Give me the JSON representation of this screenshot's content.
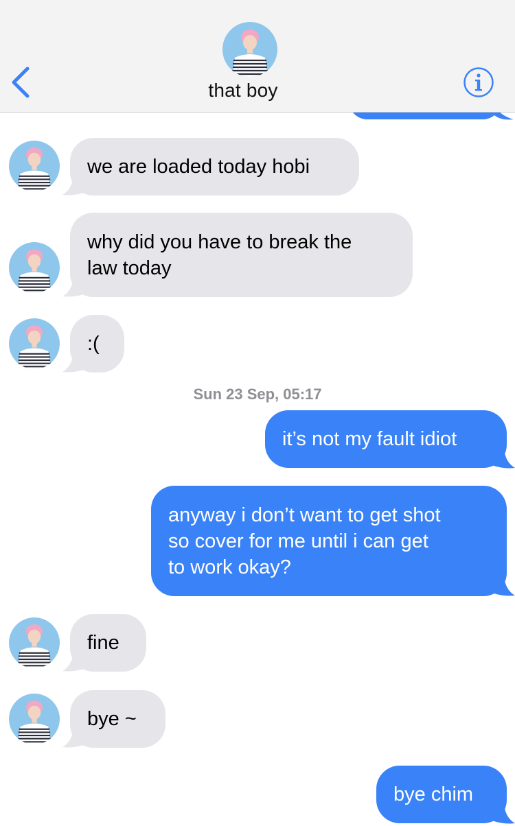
{
  "header": {
    "back_icon": "chevron-left-icon",
    "contact_name": "that boy",
    "info_icon": "info-circle-icon",
    "accent_color": "#3a82f7"
  },
  "conversation": {
    "messages": [
      {
        "direction": "incoming",
        "text": "we are loaded today hobi"
      },
      {
        "direction": "incoming",
        "text": "why did you have to break the\nlaw today"
      },
      {
        "direction": "incoming",
        "text": ":("
      },
      {
        "type": "timestamp",
        "text": "Sun 23 Sep, 05:17"
      },
      {
        "direction": "outgoing",
        "text": "it’s not my fault idiot"
      },
      {
        "direction": "outgoing",
        "text": "anyway i don’t want to get shot\nso cover for me until i can get\nto work okay?"
      },
      {
        "direction": "incoming",
        "text": "fine"
      },
      {
        "direction": "incoming",
        "text": "bye ~"
      },
      {
        "direction": "outgoing",
        "text": "bye chim"
      }
    ]
  },
  "colors": {
    "incoming_bubble": "#e6e5ea",
    "outgoing_bubble": "#3a82f7",
    "header_bg": "#f4f3f4"
  }
}
